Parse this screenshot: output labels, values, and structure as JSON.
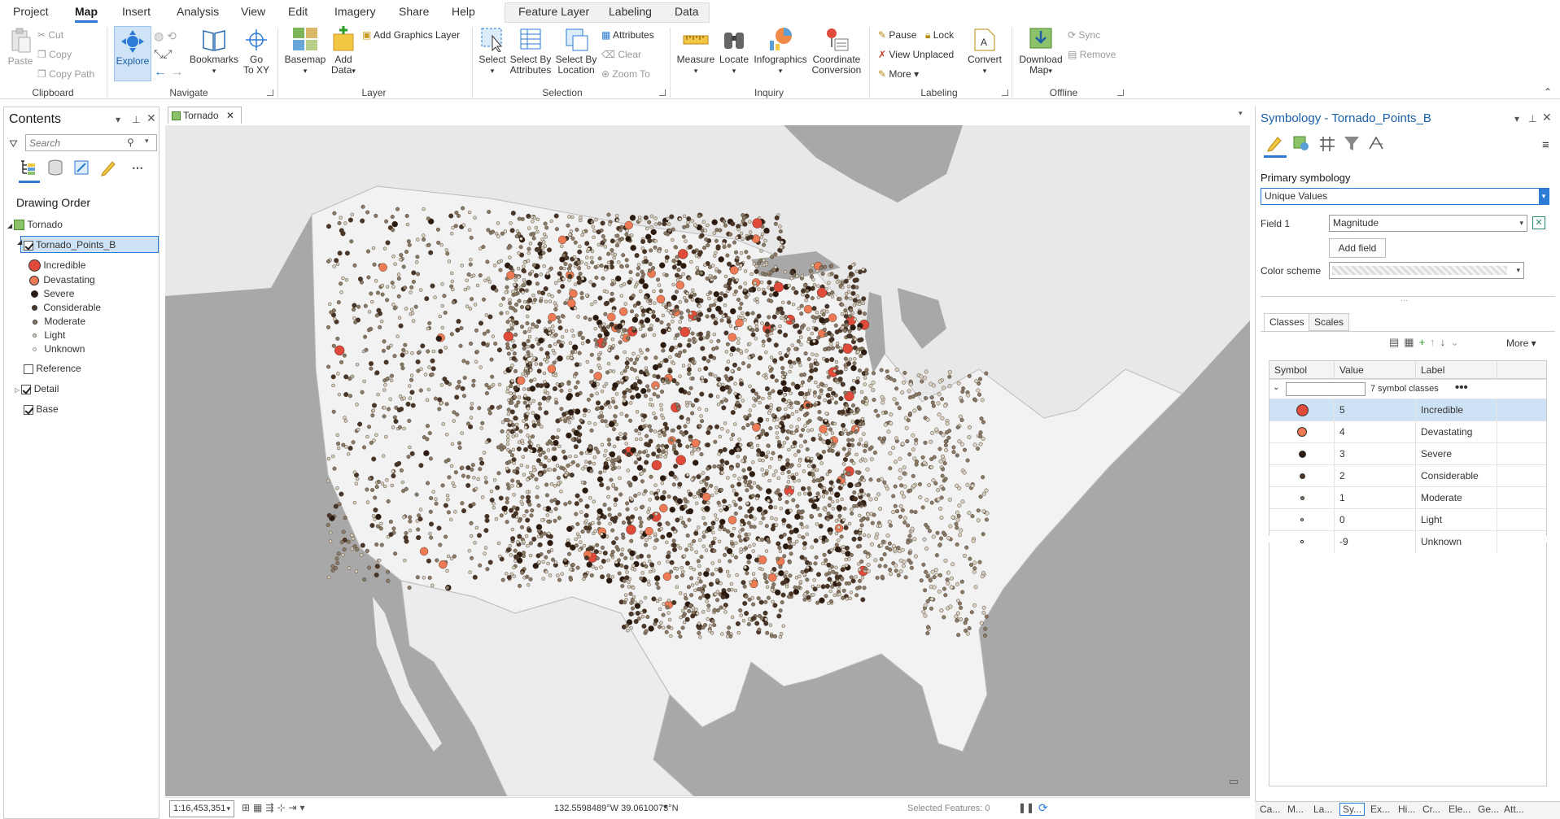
{
  "menu": {
    "tabs": [
      "Project",
      "Map",
      "Insert",
      "Analysis",
      "View",
      "Edit",
      "Imagery",
      "Share",
      "Help"
    ],
    "active": "Map",
    "context_tabs": [
      "Feature Layer",
      "Labeling",
      "Data"
    ]
  },
  "ribbon": {
    "clipboard": {
      "paste": "Paste",
      "cut": "Cut",
      "copy": "Copy",
      "copy_path": "Copy Path",
      "label": "Clipboard"
    },
    "navigate": {
      "explore": "Explore",
      "bookmarks": "Bookmarks",
      "goto_1": "Go",
      "goto_2": "To XY",
      "label": "Navigate"
    },
    "layer": {
      "basemap": "Basemap",
      "add_data_1": "Add",
      "add_data_2": "Data",
      "add_graphics": "Add Graphics Layer",
      "label": "Layer"
    },
    "selection": {
      "select": "Select",
      "by_attr_1": "Select By",
      "by_attr_2": "Attributes",
      "by_loc_1": "Select By",
      "by_loc_2": "Location",
      "attributes": "Attributes",
      "clear": "Clear",
      "zoom_to": "Zoom To",
      "label": "Selection"
    },
    "inquiry": {
      "measure": "Measure",
      "locate": "Locate",
      "infographics": "Infographics",
      "coord_1": "Coordinate",
      "coord_2": "Conversion",
      "label": "Inquiry"
    },
    "labeling": {
      "pause": "Pause",
      "lock": "Lock",
      "view_unplaced": "View Unplaced",
      "more": "More",
      "convert": "Convert",
      "label": "Labeling"
    },
    "offline": {
      "download_1": "Download",
      "download_2": "Map",
      "sync": "Sync",
      "remove": "Remove",
      "label": "Offline"
    }
  },
  "contents": {
    "title": "Contents",
    "search_placeholder": "Search",
    "drawing_order": "Drawing Order",
    "map_name": "Tornado",
    "layer_name": "Tornado_Points_B",
    "legend": [
      {
        "label": "Incredible",
        "color": "#e04a3a"
      },
      {
        "label": "Devastating",
        "color": "#ee7a55"
      },
      {
        "label": "Severe",
        "color": "#2b1a10"
      },
      {
        "label": "Considerable",
        "color": "#4a3628"
      },
      {
        "label": "Moderate",
        "color": "#8a7a68"
      },
      {
        "label": "Light",
        "color": "#d8d0c0"
      },
      {
        "label": "Unknown",
        "color": "#f4f4f4"
      }
    ],
    "other_layers": [
      {
        "label": "Reference",
        "checked": false
      },
      {
        "label": "Detail",
        "checked": true
      },
      {
        "label": "Base",
        "checked": true
      }
    ]
  },
  "map": {
    "tab_title": "Tornado",
    "scale": "1:16,453,351",
    "coordinates": "132.5598489°W 39.0610073°N",
    "selected_features": "Selected Features: 0"
  },
  "symbology": {
    "title": "Symbology - Tornado_Points_B",
    "primary_label": "Primary symbology",
    "primary_value": "Unique Values",
    "field1_label": "Field 1",
    "field1_value": "Magnitude",
    "add_field": "Add field",
    "color_scheme_label": "Color scheme",
    "tabs": [
      "Classes",
      "Scales"
    ],
    "more": "More",
    "columns": [
      "Symbol",
      "Value",
      "Label"
    ],
    "group_label": "7 symbol classes",
    "classes": [
      {
        "value": "5",
        "label": "Incredible",
        "color": "#e04a3a"
      },
      {
        "value": "4",
        "label": "Devastating",
        "color": "#ee7a55"
      },
      {
        "value": "3",
        "label": "Severe",
        "color": "#2b1a10"
      },
      {
        "value": "2",
        "label": "Considerable",
        "color": "#4a3628"
      },
      {
        "value": "1",
        "label": "Moderate",
        "color": "#8a7a68"
      },
      {
        "value": "0",
        "label": "Light",
        "color": "#d8d0c0"
      },
      {
        "value": "-9",
        "label": "Unknown",
        "color": "#f4f4f4"
      }
    ]
  },
  "bottom_tabs": [
    "Ca...",
    "M...",
    "La...",
    "Sy...",
    "Ex...",
    "Hi...",
    "Cr...",
    "Ele...",
    "Ge...",
    "Att..."
  ]
}
